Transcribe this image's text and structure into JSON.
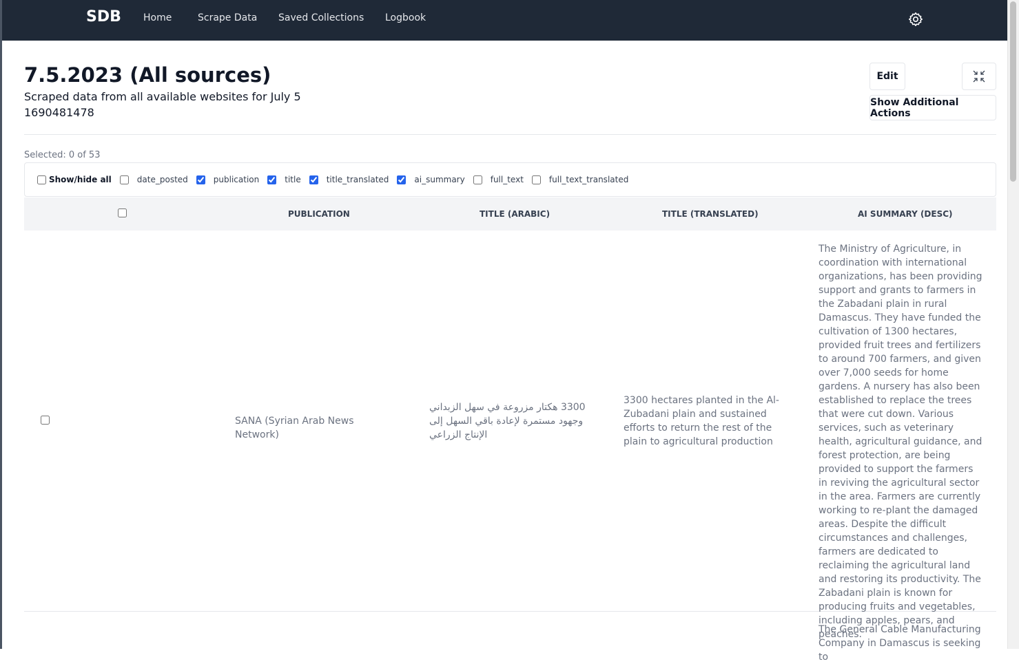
{
  "nav": {
    "brand": "SDB",
    "links": [
      "Home",
      "Scrape Data",
      "Saved Collections",
      "Logbook"
    ]
  },
  "page": {
    "title": "7.5.2023 (All sources)",
    "description": "Scraped data from all available websites for July 5",
    "id": "1690481478",
    "edit_label": "Edit",
    "actions_label": "Show Additional Actions"
  },
  "selection": {
    "text": "Selected: 0 of 53"
  },
  "column_toggles": [
    {
      "label": "Show/hide all",
      "checked": false
    },
    {
      "label": "date_posted",
      "checked": false
    },
    {
      "label": "publication",
      "checked": true
    },
    {
      "label": "title",
      "checked": true
    },
    {
      "label": "title_translated",
      "checked": true
    },
    {
      "label": "ai_summary",
      "checked": true
    },
    {
      "label": "full_text",
      "checked": false
    },
    {
      "label": "full_text_translated",
      "checked": false
    }
  ],
  "table": {
    "headers": [
      "PUBLICATION",
      "TITLE (ARABIC)",
      "TITLE (TRANSLATED)",
      "AI SUMMARY (DESC)"
    ],
    "rows": [
      {
        "publication": "SANA (Syrian Arab News Network)",
        "title_arabic": "3300 هكتار مزروعة في سهل الزبداني وجهود مستمرة لإعادة باقي السهل إلى الإنتاج الزراعي",
        "title_translated": "3300 hectares planted in the Al-Zubadani plain and sustained efforts to return the rest of the plain to agricultural production",
        "ai_summary": "The Ministry of Agriculture, in coordination with international organizations, has been providing support and grants to farmers in the Zabadani plain in rural Damascus. They have funded the cultivation of 1300 hectares, provided fruit trees and fertilizers to around 700 farmers, and given over 7,000 seeds for home gardens. A nursery has also been established to replace the trees that were cut down. Various services, such as veterinary health, agricultural guidance, and forest protection, are being provided to support the farmers in reviving the agricultural sector in the area. Farmers are currently working to re-plant the damaged areas. Despite the difficult circumstances and challenges, farmers are dedicated to reclaiming the agricultural land and restoring its productivity. The Zabadani plain is known for producing fruits and vegetables, including apples, pears, and peaches."
      },
      {
        "ai_summary": "The General Cable Manufacturing Company in Damascus is seeking to"
      }
    ]
  }
}
